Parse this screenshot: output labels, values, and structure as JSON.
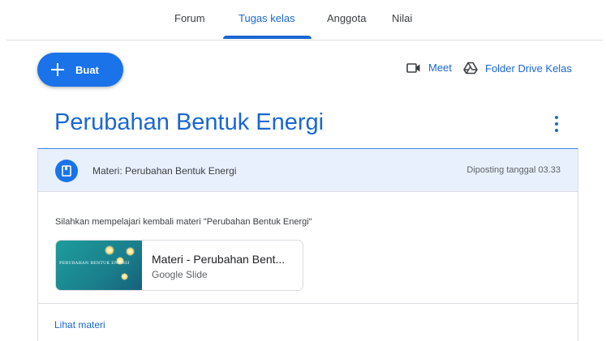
{
  "tabs": [
    {
      "label": "Forum",
      "active": false
    },
    {
      "label": "Tugas kelas",
      "active": true
    },
    {
      "label": "Anggota",
      "active": false
    },
    {
      "label": "Nilai",
      "active": false
    }
  ],
  "toolbar": {
    "create_label": "Buat",
    "meet_label": "Meet",
    "drive_label": "Folder Drive Kelas"
  },
  "topic": {
    "title": "Perubahan Bentuk Energi"
  },
  "material": {
    "header_title": "Materi: Perubahan Bentuk Energi",
    "posted": "Diposting tanggal 03.33",
    "description": "Silahkan mempelajari kembali materi \"Perubahan Bentuk Energi\"",
    "attachment": {
      "name": "Materi - Perubahan Bent...",
      "type": "Google Slide",
      "thumbnail_title": "PERUBAHAN BENTUK ENERGI"
    },
    "view_label": "Lihat materi"
  },
  "colors": {
    "accent": "#1967d2",
    "button": "#1a73e8",
    "header_bg": "#e8f0fe"
  }
}
